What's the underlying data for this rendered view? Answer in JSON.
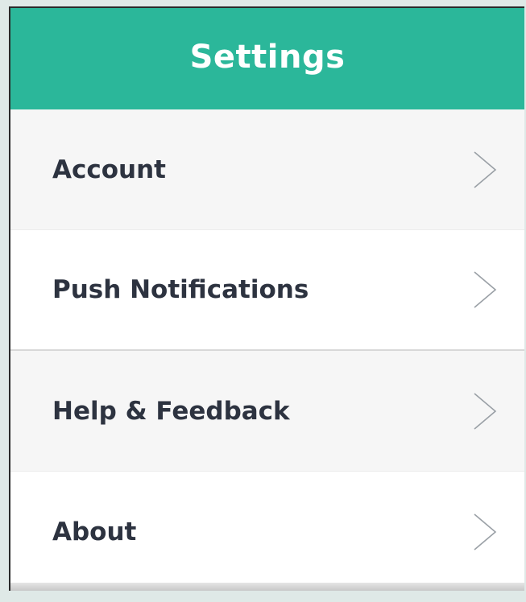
{
  "header": {
    "title": "Settings"
  },
  "settings": {
    "items": [
      {
        "label": "Account",
        "icon": "chevron-right-icon"
      },
      {
        "label": "Push Notifications",
        "icon": "chevron-right-icon"
      },
      {
        "label": "Help & Feedback",
        "icon": "chevron-right-icon"
      },
      {
        "label": "About",
        "icon": "chevron-right-icon"
      }
    ]
  },
  "colors": {
    "header": "#2bb79a",
    "header_text": "#ffffff",
    "row_text": "#2d3340",
    "chevron": "#9aa0a6",
    "row_bg_alt": "#f6f6f6",
    "row_bg_white": "#ffffff"
  }
}
